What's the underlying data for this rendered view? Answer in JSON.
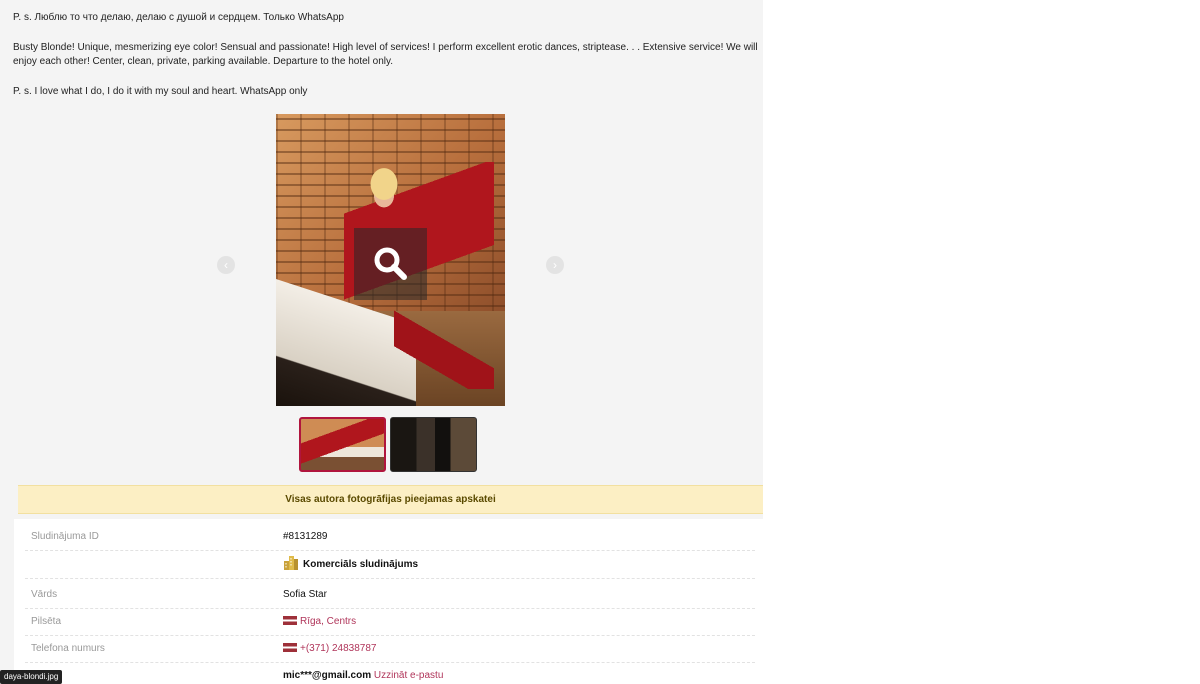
{
  "description": {
    "ru_ps": "P. s. Люблю то что делаю, делаю с душой и сердцем. Только WhatsApp",
    "en_text": "Busty Blonde! Unique, mesmerizing eye color! Sensual and passionate! High level of services! I perform excellent erotic dances, striptease. . . Extensive service! We will enjoy each other! Center, clean, private, parking available. Departure to the hotel only.",
    "en_ps": "P. s. I love what I do, I do it with my soul and heart. WhatsApp only"
  },
  "gallery": {
    "prev_glyph": "‹",
    "next_glyph": "›",
    "zoom_icon": "search-icon",
    "thumbnails": [
      "thumb-1",
      "thumb-2"
    ]
  },
  "notice": {
    "text": "Visas autora fotogrāfijas pieejamas apskatei"
  },
  "info": {
    "id_label": "Sludinājuma ID",
    "id_value": "#8131289",
    "commercial_label": "Komerciāls sludinājums",
    "name_label": "Vārds",
    "name_value": "Sofia Star",
    "city_label": "Pilsēta",
    "city_value": "Rīga, Centrs",
    "phone_label": "Telefona numurs",
    "phone_value": "+(371) 24838787",
    "email_value": "mic***@gmail.com",
    "email_link": "Uzzināt e-pastu"
  },
  "tooltip": {
    "text": "daya-blondi.jpg"
  },
  "colors": {
    "link": "#b0355a",
    "notice_bg": "#fcefc4",
    "flag_red": "#9e3039"
  }
}
